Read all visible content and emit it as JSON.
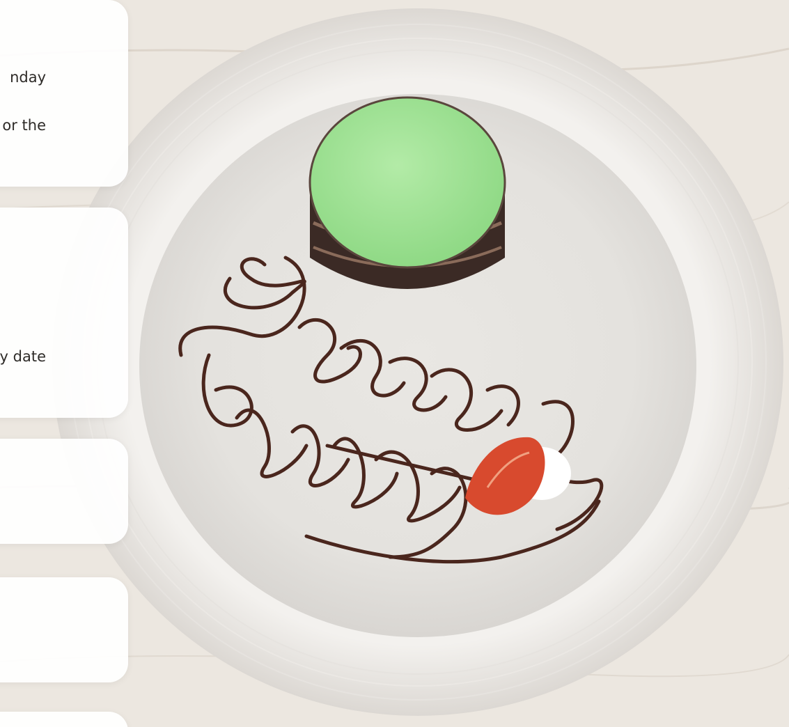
{
  "cards": [
    {
      "lines": [
        "nday",
        "or the"
      ]
    },
    {
      "lines": [
        "ary date"
      ]
    },
    {
      "lines": []
    },
    {
      "lines": []
    },
    {
      "lines": []
    }
  ],
  "photo": {
    "subject": "birthday-dessert-plate",
    "plate_text": "Happy Birthday",
    "colors": {
      "table": "#ebe6df",
      "plate": "#e7e5e1",
      "cake_top": "#9fe295",
      "cake_side": "#3b2a25",
      "chocolate": "#4a261d",
      "strawberry": "#d84a2e",
      "cream": "#ffffff"
    }
  }
}
